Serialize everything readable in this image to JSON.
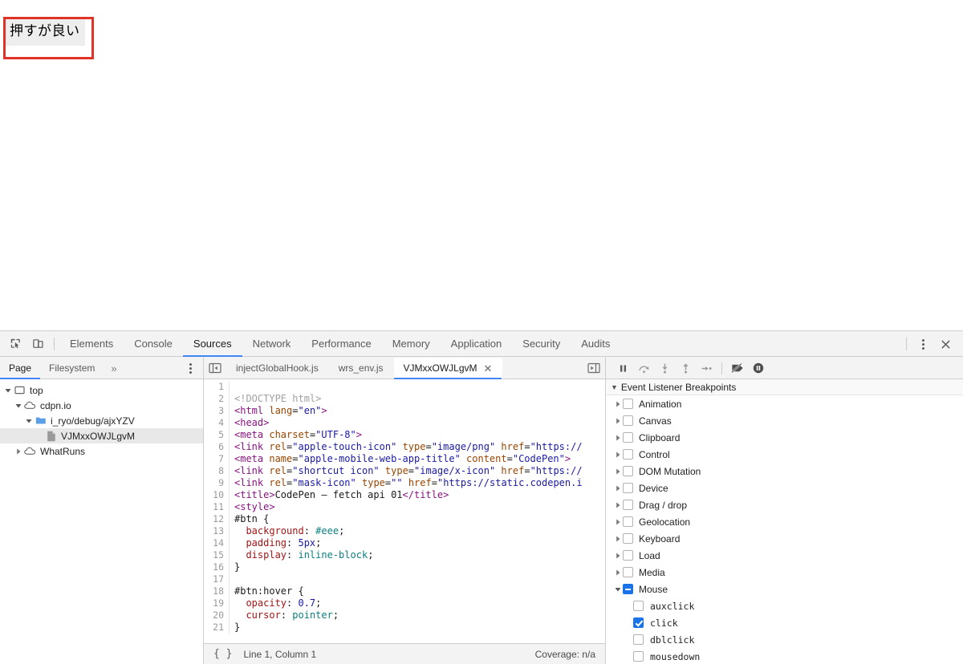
{
  "page": {
    "button_label": "押すが良い",
    "highlight_color": "#e03226",
    "button_bg": "#eeeeee"
  },
  "devtools": {
    "main_tabs": [
      {
        "label": "Elements",
        "active": false
      },
      {
        "label": "Console",
        "active": false
      },
      {
        "label": "Sources",
        "active": true
      },
      {
        "label": "Network",
        "active": false
      },
      {
        "label": "Performance",
        "active": false
      },
      {
        "label": "Memory",
        "active": false
      },
      {
        "label": "Application",
        "active": false
      },
      {
        "label": "Security",
        "active": false
      },
      {
        "label": "Audits",
        "active": false
      }
    ],
    "accent_color": "#4285f4",
    "icons": {
      "inspect": "inspect-element-icon",
      "device": "device-toolbar-icon",
      "more": "more-options-icon",
      "close": "close-devtools-icon"
    }
  },
  "navigator": {
    "tabs": [
      {
        "label": "Page",
        "active": true
      },
      {
        "label": "Filesystem",
        "active": false
      }
    ],
    "overflow": "»",
    "tree": [
      {
        "label": "top",
        "icon": "frame-icon",
        "depth": 0,
        "twisty": "open",
        "selected": false
      },
      {
        "label": "cdpn.io",
        "icon": "cloud-icon",
        "depth": 1,
        "twisty": "open",
        "selected": false
      },
      {
        "label": "i_ryo/debug/ajxYZV",
        "icon": "folder-icon",
        "depth": 2,
        "twisty": "open",
        "selected": false
      },
      {
        "label": "VJMxxOWJLgvM",
        "icon": "document-icon",
        "depth": 3,
        "twisty": "none",
        "selected": true
      },
      {
        "label": "WhatRuns",
        "icon": "cloud-icon",
        "depth": 1,
        "twisty": "closed",
        "selected": false
      }
    ]
  },
  "editor": {
    "tabs": [
      {
        "label": "injectGlobalHook.js",
        "active": false,
        "closable": false
      },
      {
        "label": "wrs_env.js",
        "active": false,
        "closable": false
      },
      {
        "label": "VJMxxOWJLgvM",
        "active": true,
        "closable": true
      }
    ],
    "close_glyph": "✕",
    "status": {
      "pretty_print": "{ }",
      "position": "Line 1, Column 1",
      "coverage": "Coverage: n/a"
    },
    "code_lines": [
      {
        "n": 1,
        "tokens": []
      },
      {
        "n": 2,
        "tokens": [
          {
            "t": "com",
            "s": "<!DOCTYPE html>"
          }
        ]
      },
      {
        "n": 3,
        "tokens": [
          {
            "t": "tag",
            "s": "<html "
          },
          {
            "t": "attr",
            "s": "lang"
          },
          {
            "t": "txt",
            "s": "="
          },
          {
            "t": "val",
            "s": "\"en\""
          },
          {
            "t": "tag",
            "s": ">"
          }
        ]
      },
      {
        "n": 4,
        "tokens": [
          {
            "t": "tag",
            "s": "<head>"
          }
        ]
      },
      {
        "n": 5,
        "tokens": [
          {
            "t": "tag",
            "s": "<meta "
          },
          {
            "t": "attr",
            "s": "charset"
          },
          {
            "t": "txt",
            "s": "="
          },
          {
            "t": "val",
            "s": "\"UTF-8\""
          },
          {
            "t": "tag",
            "s": ">"
          }
        ]
      },
      {
        "n": 6,
        "tokens": [
          {
            "t": "tag",
            "s": "<link "
          },
          {
            "t": "attr",
            "s": "rel"
          },
          {
            "t": "txt",
            "s": "="
          },
          {
            "t": "val",
            "s": "\"apple-touch-icon\""
          },
          {
            "t": "txt",
            "s": " "
          },
          {
            "t": "attr",
            "s": "type"
          },
          {
            "t": "txt",
            "s": "="
          },
          {
            "t": "val",
            "s": "\"image/png\""
          },
          {
            "t": "txt",
            "s": " "
          },
          {
            "t": "attr",
            "s": "href"
          },
          {
            "t": "txt",
            "s": "="
          },
          {
            "t": "val",
            "s": "\"https://"
          }
        ]
      },
      {
        "n": 7,
        "tokens": [
          {
            "t": "tag",
            "s": "<meta "
          },
          {
            "t": "attr",
            "s": "name"
          },
          {
            "t": "txt",
            "s": "="
          },
          {
            "t": "val",
            "s": "\"apple-mobile-web-app-title\""
          },
          {
            "t": "txt",
            "s": " "
          },
          {
            "t": "attr",
            "s": "content"
          },
          {
            "t": "txt",
            "s": "="
          },
          {
            "t": "val",
            "s": "\"CodePen\""
          },
          {
            "t": "tag",
            "s": ">"
          }
        ]
      },
      {
        "n": 8,
        "tokens": [
          {
            "t": "tag",
            "s": "<link "
          },
          {
            "t": "attr",
            "s": "rel"
          },
          {
            "t": "txt",
            "s": "="
          },
          {
            "t": "val",
            "s": "\"shortcut icon\""
          },
          {
            "t": "txt",
            "s": " "
          },
          {
            "t": "attr",
            "s": "type"
          },
          {
            "t": "txt",
            "s": "="
          },
          {
            "t": "val",
            "s": "\"image/x-icon\""
          },
          {
            "t": "txt",
            "s": " "
          },
          {
            "t": "attr",
            "s": "href"
          },
          {
            "t": "txt",
            "s": "="
          },
          {
            "t": "val",
            "s": "\"https://"
          }
        ]
      },
      {
        "n": 9,
        "tokens": [
          {
            "t": "tag",
            "s": "<link "
          },
          {
            "t": "attr",
            "s": "rel"
          },
          {
            "t": "txt",
            "s": "="
          },
          {
            "t": "val",
            "s": "\"mask-icon\""
          },
          {
            "t": "txt",
            "s": " "
          },
          {
            "t": "attr",
            "s": "type"
          },
          {
            "t": "txt",
            "s": "="
          },
          {
            "t": "val",
            "s": "\"\""
          },
          {
            "t": "txt",
            "s": " "
          },
          {
            "t": "attr",
            "s": "href"
          },
          {
            "t": "txt",
            "s": "="
          },
          {
            "t": "val",
            "s": "\"https://static.codepen.i"
          }
        ]
      },
      {
        "n": 10,
        "tokens": [
          {
            "t": "tag",
            "s": "<title>"
          },
          {
            "t": "txt",
            "s": "CodePen – fetch api 01"
          },
          {
            "t": "tag",
            "s": "</title>"
          }
        ]
      },
      {
        "n": 11,
        "tokens": [
          {
            "t": "tag",
            "s": "<style>"
          }
        ]
      },
      {
        "n": 12,
        "tokens": [
          {
            "t": "sel",
            "s": "#btn {"
          }
        ]
      },
      {
        "n": 13,
        "tokens": [
          {
            "t": "txt",
            "s": "  "
          },
          {
            "t": "prop",
            "s": "background"
          },
          {
            "t": "txt",
            "s": ": "
          },
          {
            "t": "cval",
            "s": "#eee"
          },
          {
            "t": "txt",
            "s": ";"
          }
        ]
      },
      {
        "n": 14,
        "tokens": [
          {
            "t": "txt",
            "s": "  "
          },
          {
            "t": "prop",
            "s": "padding"
          },
          {
            "t": "txt",
            "s": ": "
          },
          {
            "t": "num",
            "s": "5px"
          },
          {
            "t": "txt",
            "s": ";"
          }
        ]
      },
      {
        "n": 15,
        "tokens": [
          {
            "t": "txt",
            "s": "  "
          },
          {
            "t": "prop",
            "s": "display"
          },
          {
            "t": "txt",
            "s": ": "
          },
          {
            "t": "cval",
            "s": "inline-block"
          },
          {
            "t": "txt",
            "s": ";"
          }
        ]
      },
      {
        "n": 16,
        "tokens": [
          {
            "t": "sel",
            "s": "}"
          }
        ]
      },
      {
        "n": 17,
        "tokens": []
      },
      {
        "n": 18,
        "tokens": [
          {
            "t": "sel",
            "s": "#btn:hover {"
          }
        ]
      },
      {
        "n": 19,
        "tokens": [
          {
            "t": "txt",
            "s": "  "
          },
          {
            "t": "prop",
            "s": "opacity"
          },
          {
            "t": "txt",
            "s": ": "
          },
          {
            "t": "num",
            "s": "0.7"
          },
          {
            "t": "txt",
            "s": ";"
          }
        ]
      },
      {
        "n": 20,
        "tokens": [
          {
            "t": "txt",
            "s": "  "
          },
          {
            "t": "prop",
            "s": "cursor"
          },
          {
            "t": "txt",
            "s": ": "
          },
          {
            "t": "cval",
            "s": "pointer"
          },
          {
            "t": "txt",
            "s": ";"
          }
        ]
      },
      {
        "n": 21,
        "tokens": [
          {
            "t": "sel",
            "s": "}"
          }
        ]
      }
    ]
  },
  "debugger": {
    "toolbar_icons": [
      "pause-script-icon",
      "step-over-icon",
      "step-into-icon",
      "step-out-icon",
      "step-icon",
      "deactivate-breakpoints-icon",
      "pause-on-exceptions-icon"
    ],
    "section_title": "Event Listener Breakpoints",
    "categories": [
      {
        "label": "Animation",
        "state": "unchecked",
        "expanded": false
      },
      {
        "label": "Canvas",
        "state": "unchecked",
        "expanded": false
      },
      {
        "label": "Clipboard",
        "state": "unchecked",
        "expanded": false
      },
      {
        "label": "Control",
        "state": "unchecked",
        "expanded": false
      },
      {
        "label": "DOM Mutation",
        "state": "unchecked",
        "expanded": false
      },
      {
        "label": "Device",
        "state": "unchecked",
        "expanded": false
      },
      {
        "label": "Drag / drop",
        "state": "unchecked",
        "expanded": false
      },
      {
        "label": "Geolocation",
        "state": "unchecked",
        "expanded": false
      },
      {
        "label": "Keyboard",
        "state": "unchecked",
        "expanded": false
      },
      {
        "label": "Load",
        "state": "unchecked",
        "expanded": false
      },
      {
        "label": "Media",
        "state": "unchecked",
        "expanded": false
      },
      {
        "label": "Mouse",
        "state": "indeterminate",
        "expanded": true
      }
    ],
    "mouse_events": [
      {
        "label": "auxclick",
        "state": "unchecked"
      },
      {
        "label": "click",
        "state": "checked"
      },
      {
        "label": "dblclick",
        "state": "unchecked"
      },
      {
        "label": "mousedown",
        "state": "unchecked"
      }
    ],
    "checked_color": "#1a73e8"
  }
}
